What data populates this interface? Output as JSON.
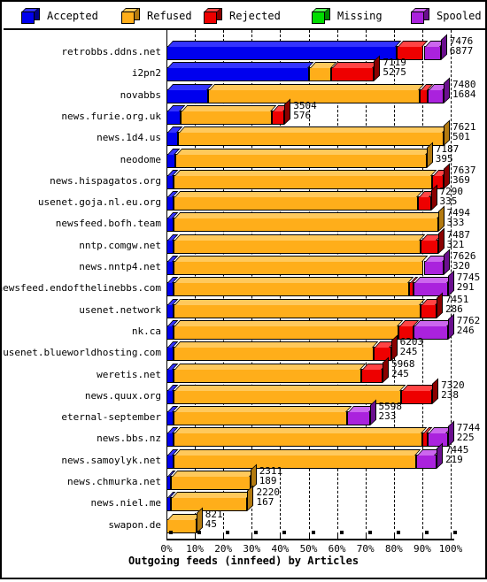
{
  "legend": {
    "items": [
      {
        "label": "Accepted",
        "color": "#0000ee",
        "side": "#000088",
        "top": "#3333ff"
      },
      {
        "label": "Refused",
        "color": "#ffae1a",
        "side": "#b37a10",
        "top": "#ffc95c"
      },
      {
        "label": "Rejected",
        "color": "#ee0000",
        "side": "#8b0000",
        "top": "#ff4444"
      },
      {
        "label": "Missing",
        "color": "#00dd00",
        "side": "#008800",
        "top": "#55ff55"
      },
      {
        "label": "Spooled",
        "color": "#aa22dd",
        "side": "#6b0f8f",
        "top": "#cc66ee"
      }
    ]
  },
  "chart_data": {
    "type": "bar",
    "title": "Outgoing feeds (innfeed) by Articles",
    "subtitle": "",
    "orientation": "horizontal",
    "stacked": true,
    "xlabel": "Outgoing feeds (innfeed) by Articles",
    "ylabel": "",
    "xlim": [
      0,
      100
    ],
    "x_unit": "percent",
    "xticks": [
      "0%",
      "10%",
      "20%",
      "30%",
      "40%",
      "50%",
      "60%",
      "70%",
      "80%",
      "90%",
      "100%"
    ],
    "xtickvalues": [
      0,
      10,
      20,
      30,
      40,
      50,
      60,
      70,
      80,
      90,
      100
    ],
    "grid": true,
    "legend_position": "top",
    "series_names": [
      "Accepted",
      "Refused",
      "Rejected",
      "Missing",
      "Spooled"
    ],
    "categories": [
      "retrobbs.ddns.net",
      "i2pn2",
      "novabbs",
      "news.furie.org.uk",
      "news.1d4.us",
      "neodome",
      "news.hispagatos.org",
      "usenet.goja.nl.eu.org",
      "newsfeed.bofh.team",
      "nntp.comgw.net",
      "news.nntp4.net",
      "newsfeed.endofthelinebbs.com",
      "usenet.network",
      "nk.ca",
      "usenet.blueworldhosting.com",
      "weretis.net",
      "news.quux.org",
      "eternal-september",
      "news.bbs.nz",
      "news.samoylyk.net",
      "news.chmurka.net",
      "news.niel.me",
      "swapon.de"
    ],
    "rows": [
      {
        "label": "retrobbs.ddns.net",
        "total": 7476,
        "offered": 6877,
        "bar_pct": 96.5,
        "segments": [
          {
            "name": "Accepted",
            "pct": 81.0
          },
          {
            "name": "Rejected",
            "pct": 9.5
          },
          {
            "name": "Spooled",
            "pct": 6.0
          }
        ]
      },
      {
        "label": "i2pn2",
        "total": 7119,
        "offered": 5275,
        "bar_pct": 73.0,
        "segments": [
          {
            "name": "Accepted",
            "pct": 50.0
          },
          {
            "name": "Refused",
            "pct": 8.0
          },
          {
            "name": "Rejected",
            "pct": 15.0
          }
        ]
      },
      {
        "label": "novabbs",
        "total": 7480,
        "offered": 1684,
        "bar_pct": 97.5,
        "segments": [
          {
            "name": "Accepted",
            "pct": 14.5
          },
          {
            "name": "Refused",
            "pct": 74.5
          },
          {
            "name": "Rejected",
            "pct": 3.0
          },
          {
            "name": "Spooled",
            "pct": 5.5
          }
        ]
      },
      {
        "label": "news.furie.org.uk",
        "total": 3504,
        "offered": 576,
        "bar_pct": 41.5,
        "segments": [
          {
            "name": "Accepted",
            "pct": 5.0
          },
          {
            "name": "Refused",
            "pct": 32.0
          },
          {
            "name": "Rejected",
            "pct": 4.5
          }
        ]
      },
      {
        "label": "news.1d4.us",
        "total": 7621,
        "offered": 501,
        "bar_pct": 97.5,
        "segments": [
          {
            "name": "Accepted",
            "pct": 4.0
          },
          {
            "name": "Refused",
            "pct": 93.5
          }
        ]
      },
      {
        "label": "neodome",
        "total": 7187,
        "offered": 395,
        "bar_pct": 91.5,
        "segments": [
          {
            "name": "Accepted",
            "pct": 3.0
          },
          {
            "name": "Refused",
            "pct": 88.5
          }
        ]
      },
      {
        "label": "news.hispagatos.org",
        "total": 7637,
        "offered": 369,
        "bar_pct": 97.5,
        "segments": [
          {
            "name": "Accepted",
            "pct": 2.5
          },
          {
            "name": "Refused",
            "pct": 91.0
          },
          {
            "name": "Rejected",
            "pct": 4.0
          }
        ]
      },
      {
        "label": "usenet.goja.nl.eu.org",
        "total": 7290,
        "offered": 335,
        "bar_pct": 93.0,
        "segments": [
          {
            "name": "Accepted",
            "pct": 2.5
          },
          {
            "name": "Refused",
            "pct": 86.0
          },
          {
            "name": "Rejected",
            "pct": 4.5
          }
        ]
      },
      {
        "label": "newsfeed.bofh.team",
        "total": 7494,
        "offered": 333,
        "bar_pct": 95.5,
        "segments": [
          {
            "name": "Accepted",
            "pct": 2.5
          },
          {
            "name": "Refused",
            "pct": 93.0
          }
        ]
      },
      {
        "label": "nntp.comgw.net",
        "total": 7487,
        "offered": 321,
        "bar_pct": 95.5,
        "segments": [
          {
            "name": "Accepted",
            "pct": 2.5
          },
          {
            "name": "Refused",
            "pct": 87.0
          },
          {
            "name": "Rejected",
            "pct": 6.0
          }
        ]
      },
      {
        "label": "news.nntp4.net",
        "total": 7626,
        "offered": 320,
        "bar_pct": 97.5,
        "segments": [
          {
            "name": "Accepted",
            "pct": 2.5
          },
          {
            "name": "Refused",
            "pct": 88.0
          },
          {
            "name": "Spooled",
            "pct": 7.0
          }
        ]
      },
      {
        "label": "newsfeed.endofthelinebbs.com",
        "total": 7745,
        "offered": 291,
        "bar_pct": 99.0,
        "segments": [
          {
            "name": "Accepted",
            "pct": 2.5
          },
          {
            "name": "Refused",
            "pct": 83.0
          },
          {
            "name": "Rejected",
            "pct": 1.5
          },
          {
            "name": "Spooled",
            "pct": 12.0
          }
        ]
      },
      {
        "label": "usenet.network",
        "total": 7451,
        "offered": 286,
        "bar_pct": 95.0,
        "segments": [
          {
            "name": "Accepted",
            "pct": 2.5
          },
          {
            "name": "Refused",
            "pct": 87.0
          },
          {
            "name": "Rejected",
            "pct": 5.5
          }
        ]
      },
      {
        "label": "nk.ca",
        "total": 7762,
        "offered": 246,
        "bar_pct": 99.0,
        "segments": [
          {
            "name": "Accepted",
            "pct": 2.5
          },
          {
            "name": "Refused",
            "pct": 79.0
          },
          {
            "name": "Rejected",
            "pct": 5.5
          },
          {
            "name": "Spooled",
            "pct": 12.0
          }
        ]
      },
      {
        "label": "usenet.blueworldhosting.com",
        "total": 6203,
        "offered": 245,
        "bar_pct": 79.0,
        "segments": [
          {
            "name": "Accepted",
            "pct": 2.5
          },
          {
            "name": "Refused",
            "pct": 70.5
          },
          {
            "name": "Rejected",
            "pct": 6.0
          }
        ]
      },
      {
        "label": "weretis.net",
        "total": 5968,
        "offered": 245,
        "bar_pct": 76.0,
        "segments": [
          {
            "name": "Accepted",
            "pct": 2.5
          },
          {
            "name": "Refused",
            "pct": 66.0
          },
          {
            "name": "Rejected",
            "pct": 7.5
          }
        ]
      },
      {
        "label": "news.quux.org",
        "total": 7320,
        "offered": 238,
        "bar_pct": 93.5,
        "segments": [
          {
            "name": "Accepted",
            "pct": 2.5
          },
          {
            "name": "Refused",
            "pct": 80.0
          },
          {
            "name": "Rejected",
            "pct": 11.0
          }
        ]
      },
      {
        "label": "eternal-september",
        "total": 5598,
        "offered": 233,
        "bar_pct": 71.5,
        "segments": [
          {
            "name": "Accepted",
            "pct": 2.5
          },
          {
            "name": "Refused",
            "pct": 61.0
          },
          {
            "name": "Spooled",
            "pct": 8.0
          }
        ]
      },
      {
        "label": "news.bbs.nz",
        "total": 7744,
        "offered": 225,
        "bar_pct": 99.0,
        "segments": [
          {
            "name": "Accepted",
            "pct": 2.5
          },
          {
            "name": "Refused",
            "pct": 87.5
          },
          {
            "name": "Rejected",
            "pct": 2.0
          },
          {
            "name": "Spooled",
            "pct": 7.0
          }
        ]
      },
      {
        "label": "news.samoylyk.net",
        "total": 7445,
        "offered": 219,
        "bar_pct": 95.0,
        "segments": [
          {
            "name": "Accepted",
            "pct": 2.5
          },
          {
            "name": "Refused",
            "pct": 85.5
          },
          {
            "name": "Spooled",
            "pct": 7.0
          }
        ]
      },
      {
        "label": "news.chmurka.net",
        "total": 2311,
        "offered": 189,
        "bar_pct": 29.5,
        "segments": [
          {
            "name": "Accepted",
            "pct": 1.5
          },
          {
            "name": "Refused",
            "pct": 28.0
          }
        ]
      },
      {
        "label": "news.niel.me",
        "total": 2220,
        "offered": 167,
        "bar_pct": 28.5,
        "segments": [
          {
            "name": "Accepted",
            "pct": 1.5
          },
          {
            "name": "Refused",
            "pct": 27.0
          }
        ]
      },
      {
        "label": "swapon.de",
        "total": 821,
        "offered": 45,
        "bar_pct": 10.5,
        "segments": [
          {
            "name": "Refused",
            "pct": 10.5
          }
        ]
      }
    ]
  }
}
